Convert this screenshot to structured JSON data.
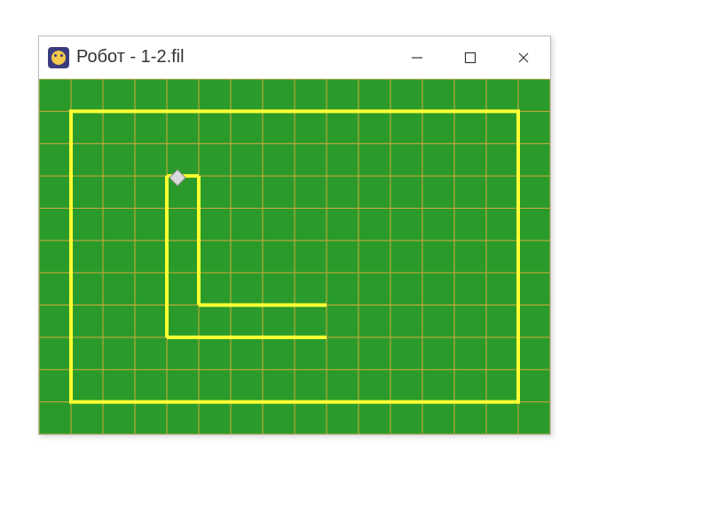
{
  "window": {
    "title": "Робот - 1-2.fil",
    "icon_name": "robot-app-icon"
  },
  "controls": {
    "minimize": "Свернуть",
    "maximize": "Развернуть",
    "close": "Закрыть"
  },
  "field": {
    "cols": 16,
    "rows": 11,
    "cell_size": 36,
    "colors": {
      "background": "#2a9b2a",
      "grid": "#d4a93a",
      "wall": "#ffff33",
      "robot_fill": "#d9d9d9",
      "robot_stroke": "#8a8a8a"
    },
    "robot": {
      "col": 3,
      "row": 3
    },
    "walls": [
      {
        "type": "rect",
        "c1": 1,
        "r1": 1,
        "c2": 15,
        "r2": 10,
        "note": "outer border"
      },
      {
        "type": "segment",
        "c1": 4,
        "r1": 3,
        "c2": 4,
        "r2": 8
      },
      {
        "type": "segment",
        "c1": 4,
        "r1": 8,
        "c2": 9,
        "r2": 8
      },
      {
        "type": "segment",
        "c1": 4,
        "r1": 3,
        "c2": 5,
        "r2": 3
      },
      {
        "type": "segment",
        "c1": 5,
        "r1": 3,
        "c2": 5,
        "r2": 7
      },
      {
        "type": "segment",
        "c1": 5,
        "r1": 7,
        "c2": 9,
        "r2": 7
      }
    ]
  }
}
